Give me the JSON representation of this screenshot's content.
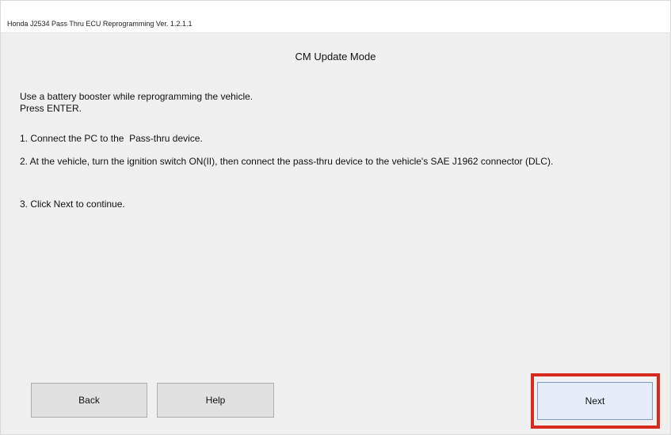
{
  "window": {
    "title": "Honda J2534 Pass Thru ECU Reprogramming Ver. 1.2.1.1"
  },
  "main": {
    "heading": "CM Update Mode",
    "instructions": {
      "line1": "Use a battery booster while reprogramming the vehicle.",
      "line2": "Press ENTER.",
      "step1": "1. Connect the PC to the  Pass-thru device.",
      "step2": "2. At the vehicle, turn the ignition switch ON(II), then connect the pass-thru device to the vehicle's SAE J1962 connector (DLC).",
      "step3": "3. Click Next to continue."
    }
  },
  "buttons": {
    "back": "Back",
    "help": "Help",
    "next": "Next"
  },
  "colors": {
    "highlight": "#d7291e",
    "background": "#f0f0f0",
    "focused_button": "#e5eef8"
  }
}
